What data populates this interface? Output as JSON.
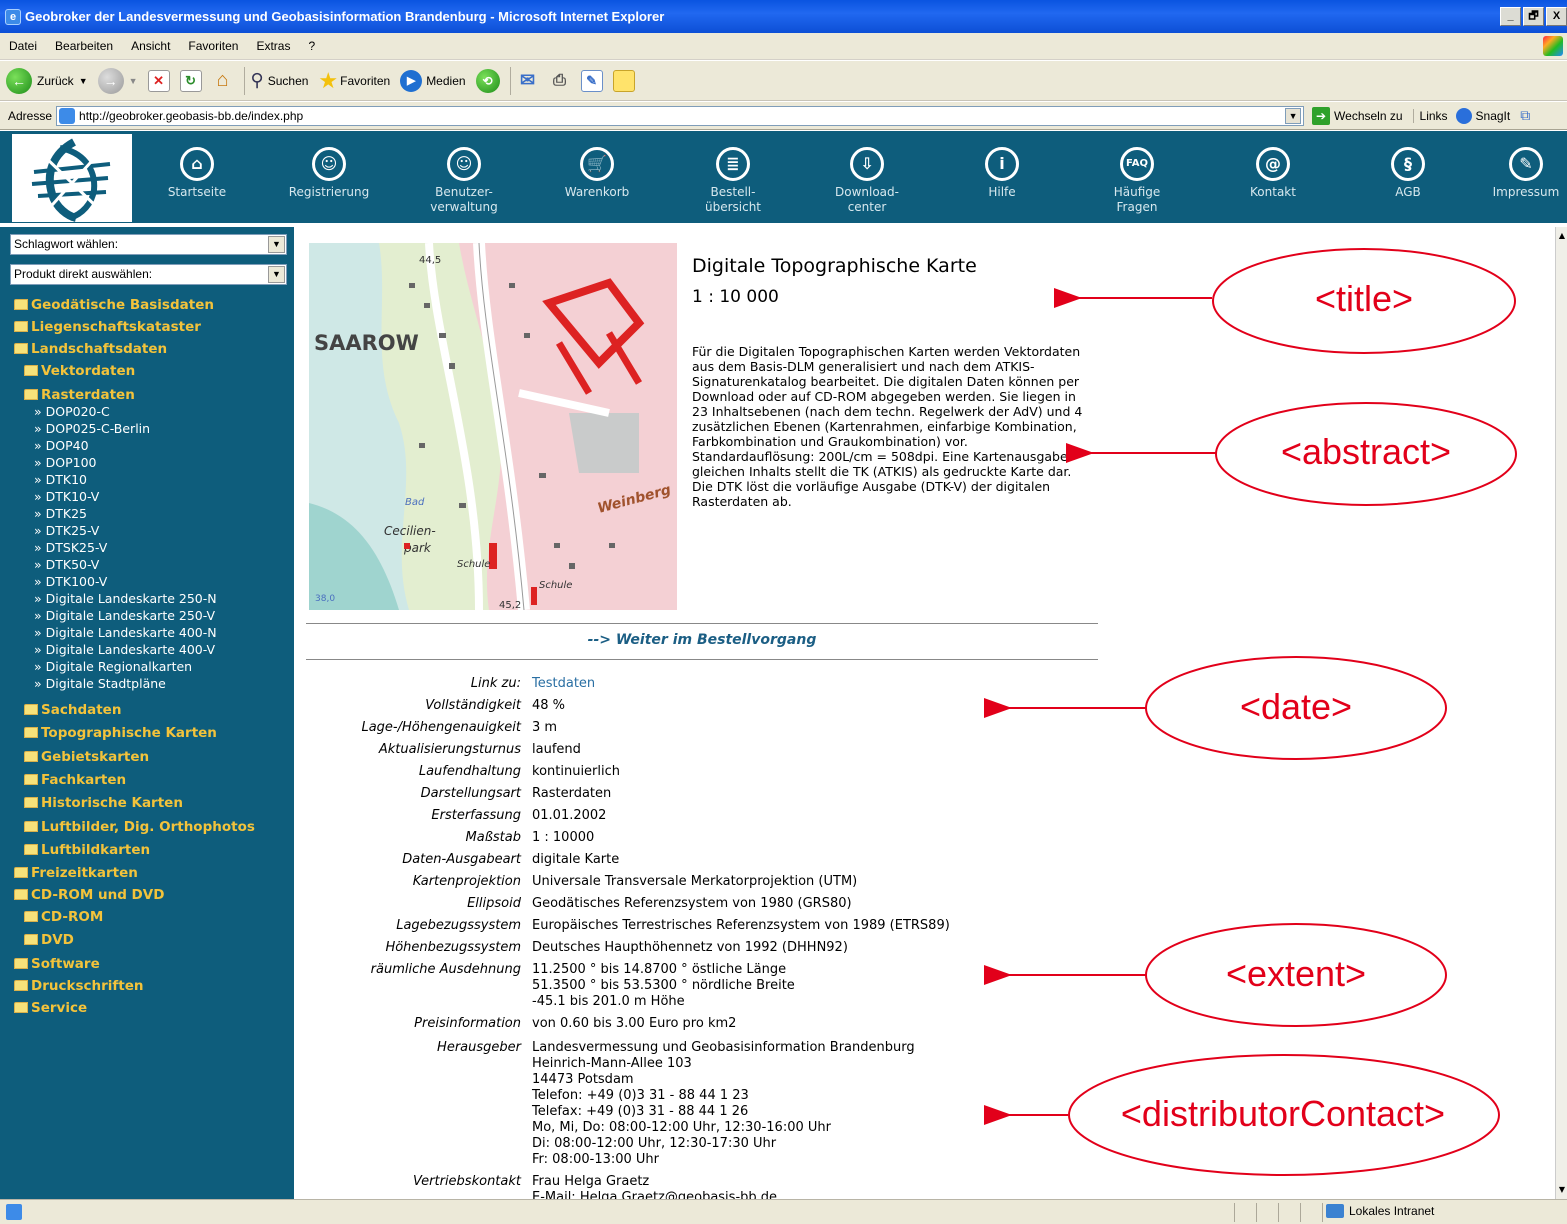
{
  "window": {
    "title": "Geobroker der Landesvermessung und Geobasisinformation Brandenburg - Microsoft Internet Explorer",
    "controls": [
      "_",
      "🗗",
      "X"
    ]
  },
  "menu": [
    "Datei",
    "Bearbeiten",
    "Ansicht",
    "Favoriten",
    "Extras",
    "?"
  ],
  "toolbar": {
    "back": "Zurück",
    "search": "Suchen",
    "favorites": "Favoriten",
    "media": "Medien"
  },
  "address": {
    "label": "Adresse",
    "url": "http://geobroker.geobasis-bb.de/index.php",
    "go": "Wechseln zu",
    "links": "Links",
    "snagit": "SnagIt"
  },
  "nav": [
    {
      "label": "Startseite",
      "icon": "home-icon",
      "glyph": "⌂"
    },
    {
      "label": "Registrierung",
      "icon": "user-icon",
      "glyph": "☺"
    },
    {
      "label": "Benutzer-\nverwaltung",
      "icon": "user-admin-icon",
      "glyph": "☺"
    },
    {
      "label": "Warenkorb",
      "icon": "cart-icon",
      "glyph": "🛒"
    },
    {
      "label": "Bestell-\nübersicht",
      "icon": "list-icon",
      "glyph": "≣"
    },
    {
      "label": "Download-\ncenter",
      "icon": "download-icon",
      "glyph": "⇩"
    },
    {
      "label": "Hilfe",
      "icon": "info-icon",
      "glyph": "i"
    },
    {
      "label": "Häufige\nFragen",
      "icon": "faq-icon",
      "glyph": "FAQ"
    },
    {
      "label": "Kontakt",
      "icon": "at-icon",
      "glyph": "@"
    },
    {
      "label": "AGB",
      "icon": "paragraph-icon",
      "glyph": "§"
    },
    {
      "label": "Impressum",
      "icon": "pen-icon",
      "glyph": "✎"
    }
  ],
  "sidebar": {
    "select1": "Schlagwort wählen:",
    "select2": "Produkt direkt auswählen:",
    "categories": [
      "Geodätische Basisdaten",
      "Liegenschaftskataster",
      "Landschaftsdaten",
      "Vektordaten",
      "Rasterdaten",
      "Sachdaten",
      "Topographische Karten",
      "Gebietskarten",
      "Fachkarten",
      "Historische Karten",
      "Luftbilder, Dig. Orthophotos",
      "Luftbildkarten",
      "Freizeitkarten",
      "CD-ROM und DVD",
      "CD-ROM",
      "DVD",
      "Software",
      "Druckschriften",
      "Service"
    ],
    "raster_items": [
      "» DOP020-C",
      "» DOP025-C-Berlin",
      "» DOP40",
      "» DOP100",
      "» DTK10",
      "» DTK10-V",
      "» DTK25",
      "» DTK25-V",
      "» DTSK25-V",
      "» DTK50-V",
      "» DTK100-V",
      "» Digitale Landeskarte 250-N",
      "» Digitale Landeskarte 250-V",
      "» Digitale Landeskarte 400-N",
      "» Digitale Landeskarte 400-V",
      "» Digitale Regionalkarten",
      "» Digitale Stadtpläne"
    ]
  },
  "product": {
    "title": "Digitale Topographische Karte",
    "scale": "1 : 10 000",
    "abstract": "Für die Digitalen Topographischen Karten werden Vektordaten aus dem Basis-DLM generalisiert und nach dem ATKIS-Signaturenkatalog bearbeitet. Die digitalen Daten können per Download oder auf CD-ROM abgegeben werden. Sie liegen in 23 Inhaltsebenen (nach dem techn. Regelwerk der AdV) und 4 zusätzlichen Ebenen (Kartenrahmen, einfarbige Kombination, Farbkombination und Graukombination) vor. Standardauflösung: 200L/cm = 508dpi. Eine Kartenausgabe gleichen Inhalts stellt die TK (ATKIS) als gedruckte Karte dar. Die DTK löst die vorläufige Ausgabe (DTK-V) der digitalen Rasterdaten ab.",
    "continue": "--> Weiter im Bestellvorgang",
    "map_labels": [
      "SAAROW",
      "Weinberg",
      "Cecilien-",
      "park",
      "Bad",
      "Schule",
      "Schule",
      "44,5",
      "45,2",
      "38,0"
    ]
  },
  "details": [
    {
      "label": "Link zu:",
      "value": "Testdaten",
      "link": true
    },
    {
      "label": "Vollständigkeit",
      "value": "48 %"
    },
    {
      "label": "Lage-/Höhengenauigkeit",
      "value": "3 m"
    },
    {
      "label": "Aktualisierungsturnus",
      "value": "laufend"
    },
    {
      "label": "Laufendhaltung",
      "value": "kontinuierlich"
    },
    {
      "label": "Darstellungsart",
      "value": "Rasterdaten"
    },
    {
      "label": "Ersterfassung",
      "value": "01.01.2002"
    },
    {
      "label": "Maßstab",
      "value": "1 : 10000"
    },
    {
      "label": "Daten-Ausgabeart",
      "value": "digitale Karte"
    },
    {
      "label": "Kartenprojektion",
      "value": "Universale Transversale Merkatorprojektion (UTM)"
    },
    {
      "label": "Ellipsoid",
      "value": "Geodätisches Referenzsystem von 1980 (GRS80)"
    },
    {
      "label": "Lagebezugssystem",
      "value": "Europäisches Terrestrisches Referenzsystem von 1989 (ETRS89)"
    },
    {
      "label": "Höhenbezugssystem",
      "value": "Deutsches Haupthöhennetz von 1992 (DHHN92)"
    },
    {
      "label": "räumliche Ausdehnung",
      "value": "11.2500 ° bis 14.8700 ° östliche Länge\n51.3500 ° bis 53.5300 ° nördliche Breite\n-45.1 bis 201.0 m Höhe"
    },
    {
      "label": "Preisinformation",
      "value": "von 0.60 bis 3.00 Euro pro km2"
    },
    {
      "label": "Herausgeber",
      "value": "Landesvermessung und Geobasisinformation Brandenburg\nHeinrich-Mann-Allee 103\n14473 Potsdam\nTelefon: +49 (0)3 31 - 88 44 1 23\nTelefax: +49 (0)3 31 - 88 44 1 26\nMo, Mi, Do: 08:00-12:00 Uhr, 12:30-16:00 Uhr\nDi: 08:00-12:00 Uhr, 12:30-17:30 Uhr\nFr: 08:00-13:00 Uhr"
    },
    {
      "label": "Vertriebskontakt",
      "value": "Frau Helga Graetz\nE-Mail: Helga.Graetz@geobasis-bb.de"
    }
  ],
  "annotations": {
    "title": "<title>",
    "abstract": "<abstract>",
    "date": "<date>",
    "extent": "<extent>",
    "contact": "<distributorContact>",
    "color": "#e2001a"
  },
  "status": {
    "zone": "Lokales Intranet"
  },
  "colors": {
    "site_teal": "#0e5d7c",
    "category_yellow": "#f3c33b",
    "link_blue": "#2a6fa3"
  }
}
